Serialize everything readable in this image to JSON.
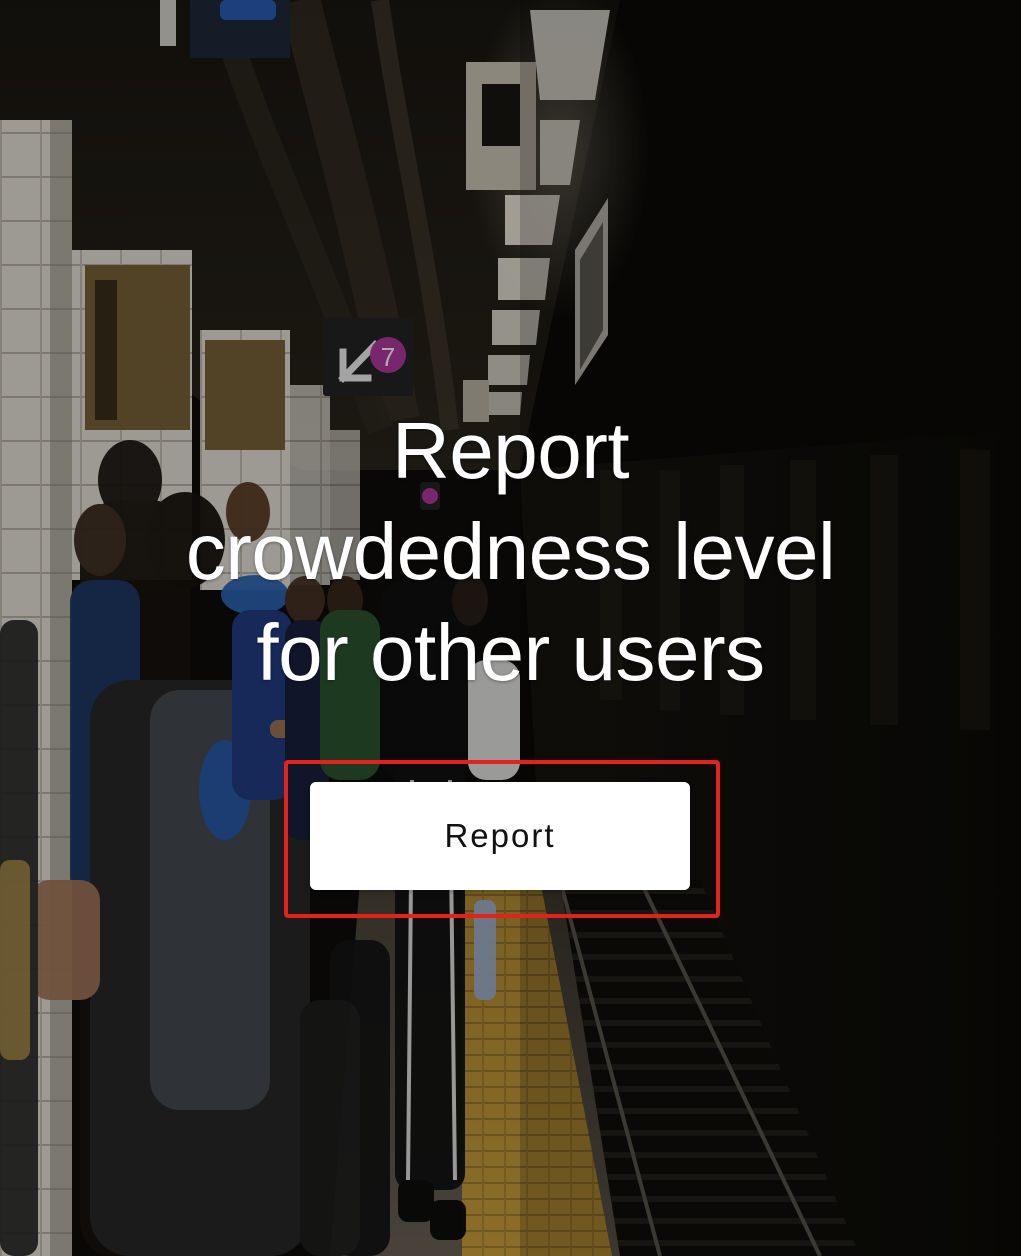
{
  "hero": {
    "headline_lines": [
      "Report",
      "crowdedness level",
      "for other users"
    ]
  },
  "action": {
    "report_label": "Report"
  },
  "background": {
    "subject": "subway-platform-photo",
    "sign_line": "7",
    "sign_arrow": "down-left-arrow-icon"
  },
  "colors": {
    "highlight": "#e3221c",
    "button_bg": "#ffffff",
    "headline": "#ffffff",
    "platform_edge": "#c9a13a"
  }
}
